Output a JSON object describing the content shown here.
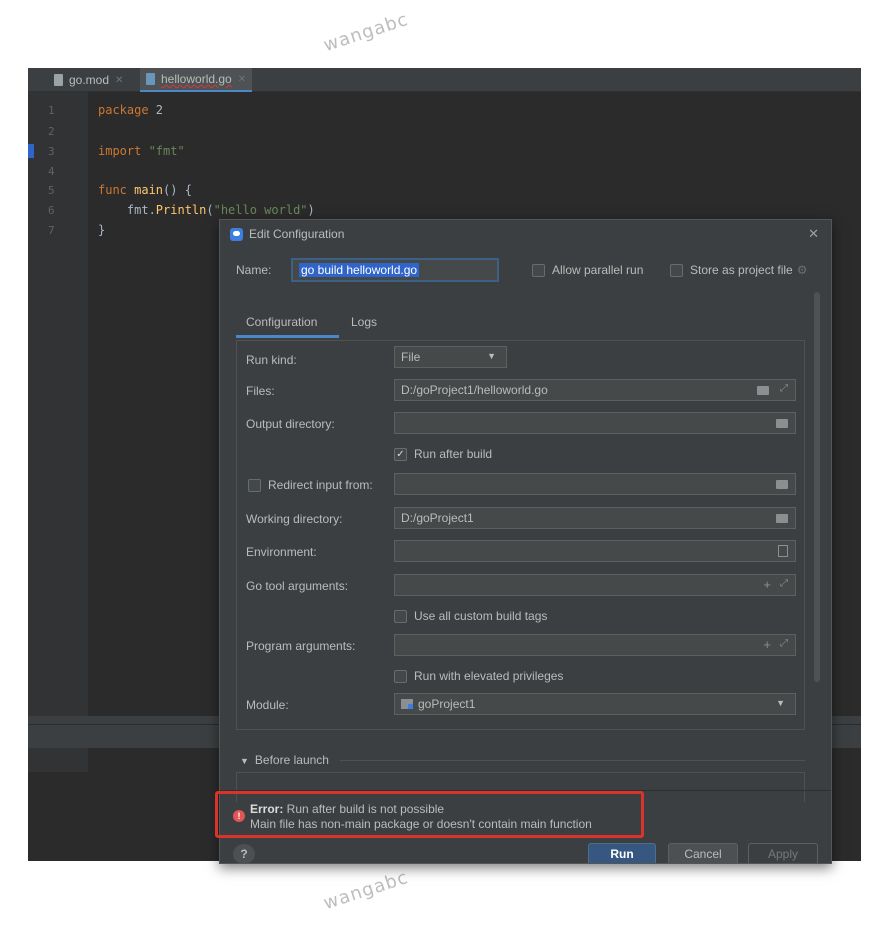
{
  "watermark": "wangabc",
  "editor": {
    "tabs": [
      {
        "label": "go.mod"
      },
      {
        "label": "helloworld.go"
      }
    ],
    "lines": [
      "1",
      "2",
      "3",
      "4",
      "5",
      "6",
      "7"
    ],
    "code": {
      "l1_kw": "package",
      "l1_rest": " 2",
      "l3_kw": "import",
      "l3_str": " \"fmt\"",
      "l5_kw": "func",
      "l5_fn": " main",
      "l5_rest": "() {",
      "l6_pre": "    fmt.",
      "l6_fn": "Println",
      "l6_open": "(",
      "l6_str": "\"hello world\"",
      "l6_close": ")",
      "l7": "}"
    }
  },
  "dialog": {
    "title": "Edit Configuration",
    "name_label": "Name:",
    "name_value": "go build helloworld.go",
    "allow_parallel": "Allow parallel run",
    "store_as_project": "Store as project file",
    "tabs": [
      "Configuration",
      "Logs"
    ],
    "fields": {
      "run_kind_label": "Run kind:",
      "run_kind_value": "File",
      "files_label": "Files:",
      "files_value": "D:/goProject1/helloworld.go",
      "output_dir_label": "Output directory:",
      "output_dir_value": "",
      "run_after_build": "Run after build",
      "redirect_input": "Redirect input from:",
      "redirect_value": "",
      "working_dir_label": "Working directory:",
      "working_dir_value": "D:/goProject1",
      "environment_label": "Environment:",
      "environment_value": "",
      "go_tool_args_label": "Go tool arguments:",
      "go_tool_args_value": "",
      "use_all_tags": "Use all custom build tags",
      "program_args_label": "Program arguments:",
      "program_args_value": "",
      "run_elevated": "Run with elevated privileges",
      "module_label": "Module:",
      "module_value": "goProject1"
    },
    "before_launch": "Before launch",
    "error_bold": "Error:",
    "error_line1": " Run after build is not possible",
    "error_line2": "Main file has non-main package or doesn't contain main function",
    "help": "?",
    "buttons": {
      "run": "Run",
      "cancel": "Cancel",
      "apply": "Apply"
    }
  },
  "colors": {
    "accent": "#3d7fe0",
    "error": "#d9342b",
    "background": "#2b2b2b"
  }
}
